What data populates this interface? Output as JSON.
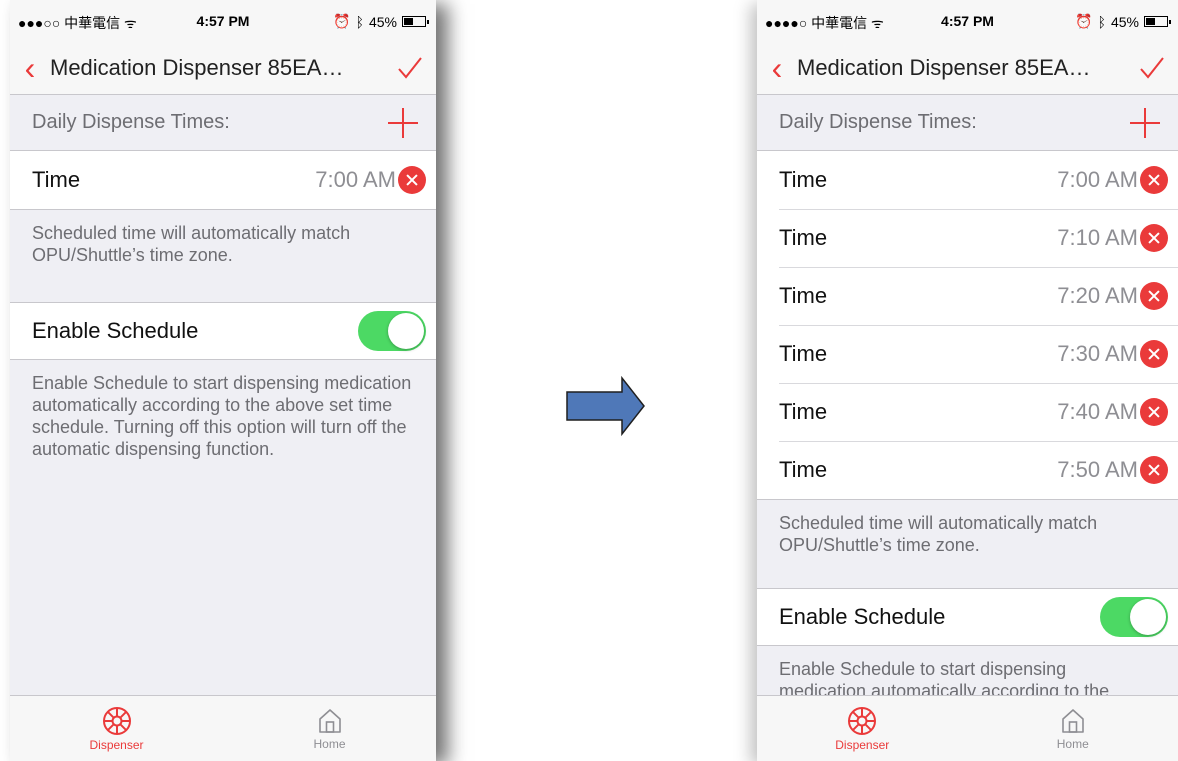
{
  "colors": {
    "accent": "#ea3a3a",
    "toggle_on": "#4cd964",
    "group_bg": "#efeff4",
    "arrow_fill": "#4f78b8"
  },
  "status_bar": {
    "left": {
      "carrier": "●●●○○ 中華電信 ᯤ"
    },
    "right": {
      "carrier": "●●●●○ 中華電信 ᯤ"
    },
    "time": "4:57 PM",
    "battery": "45%",
    "battery_level": 0.45
  },
  "nav": {
    "title": "Medication Dispenser 85EA…",
    "back_icon": "chevron-left-icon",
    "confirm_icon": "checkmark-icon"
  },
  "section": {
    "header": "Daily Dispense Times:",
    "add_icon": "plus-icon"
  },
  "left_screen": {
    "times": [
      {
        "label": "Time",
        "value": "7:00 AM"
      }
    ]
  },
  "right_screen": {
    "times": [
      {
        "label": "Time",
        "value": "7:00 AM"
      },
      {
        "label": "Time",
        "value": "7:10 AM"
      },
      {
        "label": "Time",
        "value": "7:20 AM"
      },
      {
        "label": "Time",
        "value": "7:30 AM"
      },
      {
        "label": "Time",
        "value": "7:40 AM"
      },
      {
        "label": "Time",
        "value": "7:50 AM"
      }
    ]
  },
  "notes": {
    "timezone": "Scheduled time will automatically match OPU/Shuttle’s time zone.",
    "schedule": "Enable Schedule to start dispensing medication automatically according to the above set time schedule. Turning off this option will turn off the automatic dispensing function."
  },
  "schedule": {
    "label": "Enable Schedule",
    "enabled": true
  },
  "tabs": [
    {
      "label": "Dispenser",
      "icon": "dispenser-icon",
      "active": true
    },
    {
      "label": "Home",
      "icon": "home-icon",
      "active": false
    }
  ]
}
